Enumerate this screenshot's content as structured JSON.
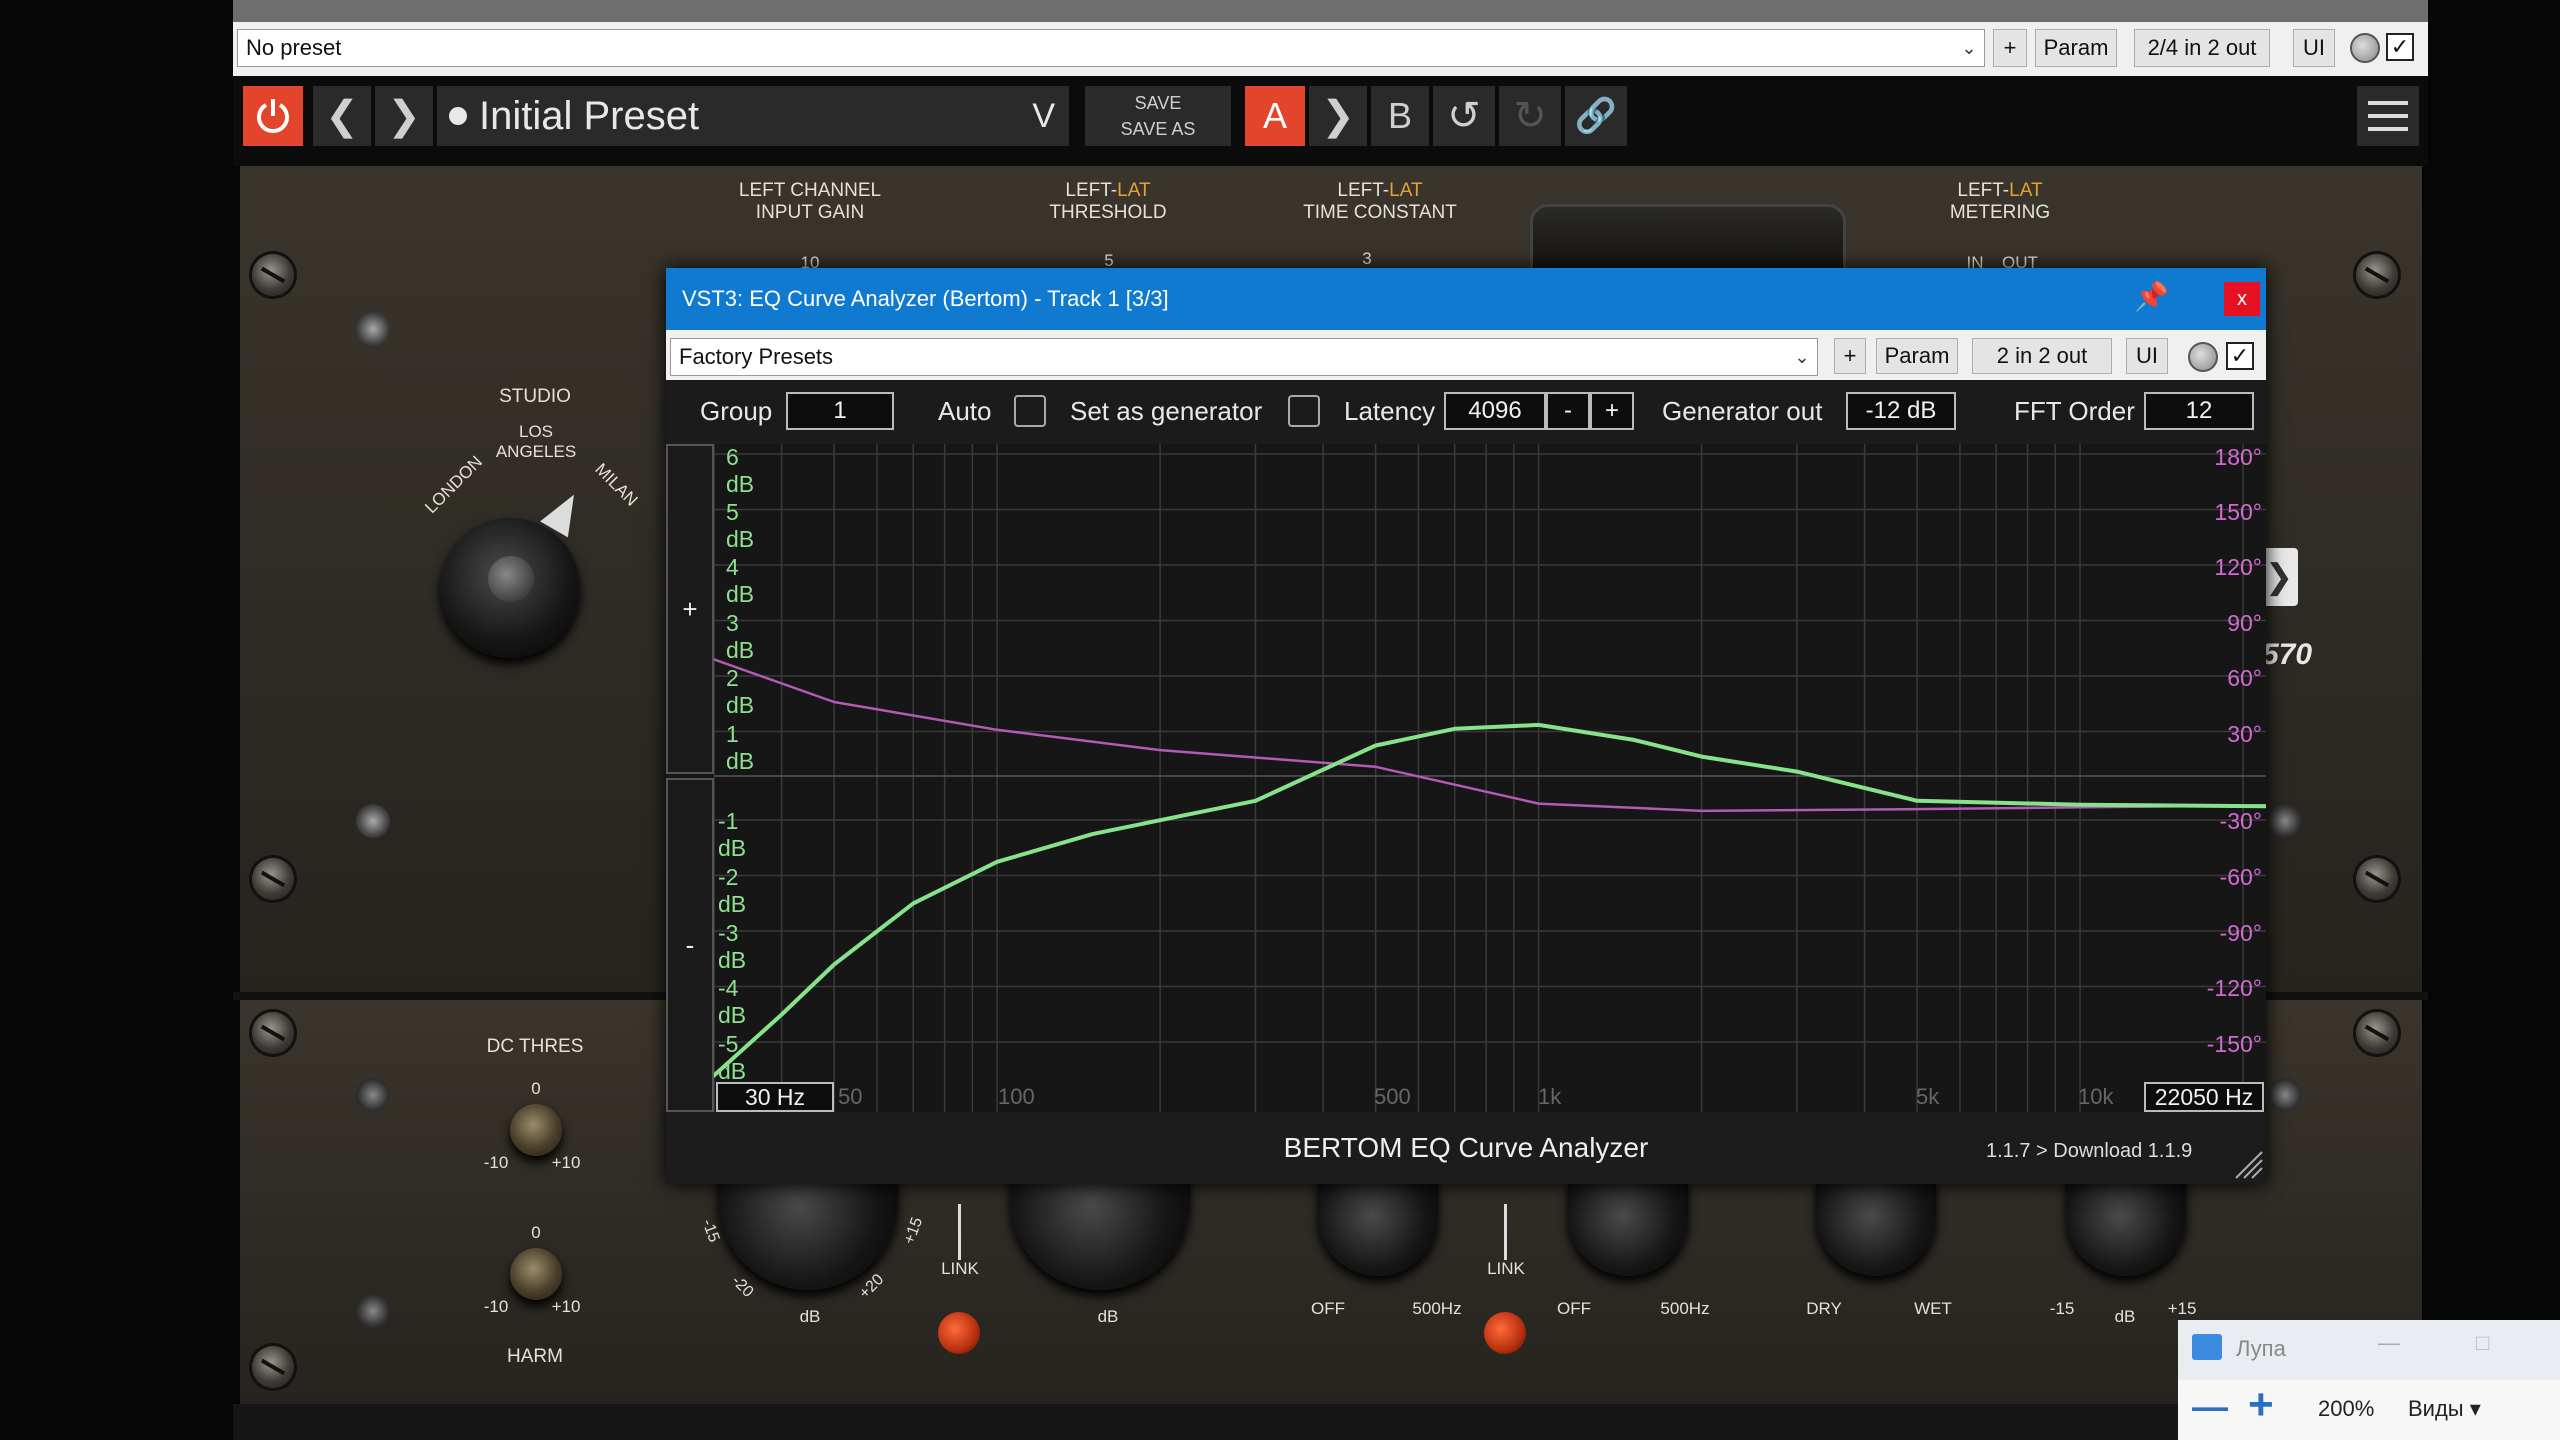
{
  "host": {
    "preset_value": "No preset",
    "plus_label": "+",
    "param_label": "Param",
    "io_label": "2/4 in 2 out",
    "ui_label": "UI"
  },
  "plugin": {
    "preset_name": "Initial Preset",
    "save_label": "SAVE",
    "save_as_label": "SAVE AS",
    "a_label": "A",
    "b_label": "B",
    "accent_color": "#e2452b"
  },
  "hardware": {
    "left_input_gain": "LEFT CHANNEL\nINPUT GAIN",
    "threshold_prefix": "LEFT-",
    "threshold_lat": "LAT",
    "threshold_label": "THRESHOLD",
    "time_prefix": "LEFT-",
    "time_lat": "LAT",
    "time_label": "TIME CONSTANT",
    "meter_prefix": "LEFT-",
    "meter_lat": "LAT",
    "meter_label": "METERING",
    "gain_tick": "10",
    "threshold_tick": "5",
    "time_tick": "3",
    "meter_in": "IN",
    "meter_out": "OUT",
    "studio_label": "STUDIO",
    "los_angeles": "LOS ANGELES",
    "london": "LONDON",
    "milan": "MILAN",
    "model_partial": "570",
    "dc_thres_label": "DC THRES",
    "dc_zero": "0",
    "dc_min": "-10",
    "dc_max": "+10",
    "harm_zero": "0",
    "harm_min": "-10",
    "harm_max": "+10",
    "harm_label": "HARM",
    "db_label": "dB",
    "db_label2": "dB",
    "link_label": "LINK",
    "link_label2": "LINK",
    "tick_m15": "-15",
    "tick_m20": "-20",
    "tick_p20": "+20",
    "tick_p15": "+15",
    "off_label": "OFF",
    "hz500_label": "500Hz",
    "off_label2": "OFF",
    "hz500_label2": "500Hz",
    "dry_label": "DRY",
    "wet_label": "WET",
    "out_min": "-15",
    "out_db": "dB",
    "out_max": "+15"
  },
  "analyzer": {
    "title": "VST3: EQ Curve Analyzer (Bertom) - Track 1 [3/3]",
    "close_label": "x",
    "preset_value": "Factory Presets",
    "plus_label": "+",
    "param_label": "Param",
    "io_label": "2 in 2 out",
    "ui_label": "UI",
    "group_label": "Group",
    "group_value": "1",
    "auto_label": "Auto",
    "generator_label": "Set as generator",
    "latency_label": "Latency",
    "latency_value": "4096",
    "latency_minus": "-",
    "latency_plus": "+",
    "genout_label": "Generator out",
    "genout_value": "-12 dB",
    "fft_label": "FFT Order",
    "fft_value": "12",
    "zoom_plus": "+",
    "zoom_minus": "-",
    "db_labels": [
      "6 dB",
      "5 dB",
      "4 dB",
      "3 dB",
      "2 dB",
      "1 dB",
      "-1 dB",
      "-2 dB",
      "-3 dB",
      "-4 dB",
      "-5 dB"
    ],
    "phase_labels": [
      "180°",
      "150°",
      "120°",
      "90°",
      "60°",
      "30°",
      "-30°",
      "-60°",
      "-90°",
      "-120°",
      "-150°"
    ],
    "freq_labels": [
      "50",
      "100",
      "500",
      "1k",
      "5k",
      "10k"
    ],
    "freq_min": "30 Hz",
    "freq_max": "22050 Hz",
    "footer_title": "BERTOM EQ Curve Analyzer",
    "version_text": "1.1.7 > Download 1.1.9",
    "magnitude_color": "#86e38b",
    "phase_color": "#b25ab4"
  },
  "chart_data": {
    "type": "line",
    "xlabel": "",
    "ylabel": "",
    "x_scale": "log",
    "xlim": [
      30,
      22050
    ],
    "ylim": [
      -5.5,
      6.2
    ],
    "y2lim": [
      -165,
      186
    ],
    "grid": true,
    "series": [
      {
        "x": [
          30,
          40,
          50,
          70,
          100,
          150,
          200,
          300,
          500,
          700,
          1000,
          1500,
          2000,
          3000,
          5000,
          10000,
          22050
        ],
        "values": [
          -5,
          -3.9,
          -3.0,
          -1.9,
          -1.15,
          -0.65,
          -0.4,
          -0.05,
          0.55,
          0.85,
          0.92,
          0.65,
          0.35,
          0.08,
          -0.05,
          -0.12,
          -0.15
        ]
      },
      {
        "axis": "right",
        "x": [
          30,
          50,
          100,
          200,
          500,
          1000,
          2000,
          5000,
          10000,
          22050
        ],
        "values": [
          63,
          40,
          25,
          14,
          5,
          -3,
          -7,
          -6,
          -5,
          -4
        ]
      }
    ]
  },
  "magnifier": {
    "title": "Лупа",
    "minus_label": "—",
    "plus_label": "+",
    "zoom_value": "200%",
    "views_label": "Виды"
  }
}
